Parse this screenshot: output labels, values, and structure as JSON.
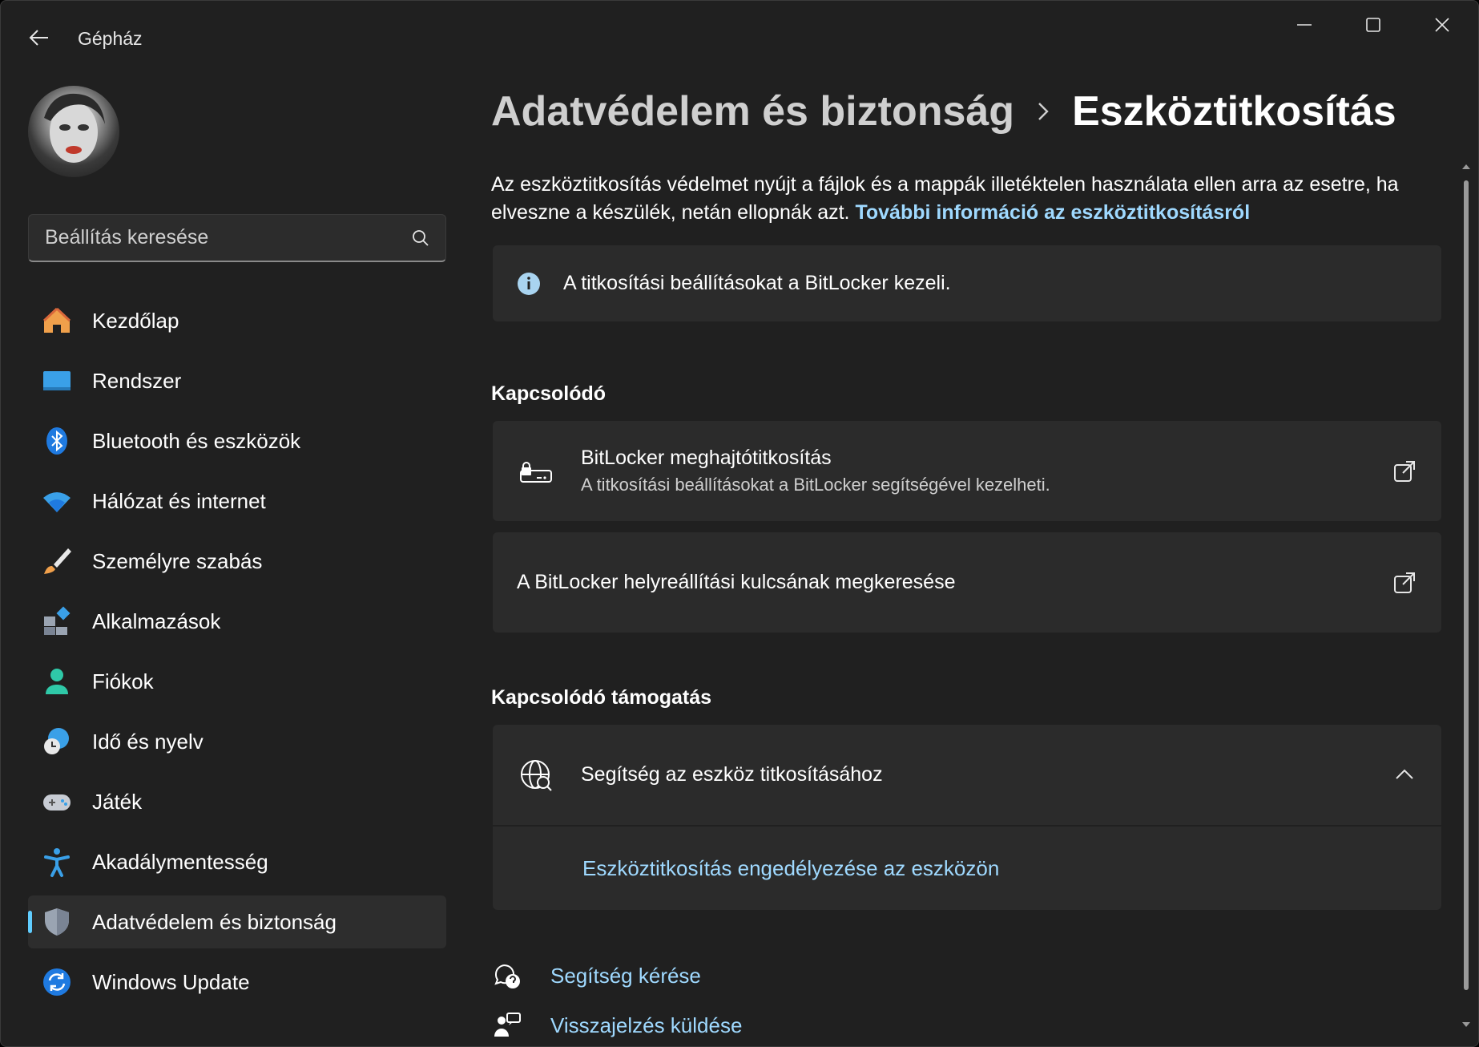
{
  "window": {
    "title": "Gépház"
  },
  "sidebar": {
    "search_placeholder": "Beállítás keresése",
    "items": [
      {
        "label": "Kezdőlap",
        "icon": "home-icon"
      },
      {
        "label": "Rendszer",
        "icon": "display-icon"
      },
      {
        "label": "Bluetooth és eszközök",
        "icon": "bluetooth-icon"
      },
      {
        "label": "Hálózat és internet",
        "icon": "wifi-icon"
      },
      {
        "label": "Személyre szabás",
        "icon": "brush-icon"
      },
      {
        "label": "Alkalmazások",
        "icon": "apps-icon"
      },
      {
        "label": "Fiókok",
        "icon": "person-icon"
      },
      {
        "label": "Idő és nyelv",
        "icon": "globe-clock-icon"
      },
      {
        "label": "Játék",
        "icon": "gamepad-icon"
      },
      {
        "label": "Akadálymentesség",
        "icon": "accessibility-icon"
      },
      {
        "label": "Adatvédelem és biztonság",
        "icon": "shield-icon",
        "active": true
      },
      {
        "label": "Windows Update",
        "icon": "update-icon"
      }
    ]
  },
  "breadcrumb": {
    "parent": "Adatvédelem és biztonság",
    "current": "Eszköztitkosítás"
  },
  "description": {
    "text": "Az eszköztitkosítás védelmet nyújt a fájlok és a mappák illetéktelen használata ellen arra az esetre, ha elveszne a készülék, netán ellopnák azt.",
    "link": "További információ az eszköztitkosításról"
  },
  "info": {
    "text": "A titkosítási beállításokat a BitLocker kezeli."
  },
  "related": {
    "title": "Kapcsolódó",
    "bitlocker": {
      "title": "BitLocker meghajtótitkosítás",
      "subtitle": "A titkosítási beállításokat a BitLocker segítségével kezelheti."
    },
    "recovery": {
      "title": "A BitLocker helyreállítási kulcsának megkeresése"
    }
  },
  "support": {
    "title": "Kapcsolódó támogatás",
    "help": {
      "title": "Segítség az eszköz titkosításához",
      "link": "Eszköztitkosítás engedélyezése az eszközön"
    }
  },
  "footer": {
    "get_help": "Segítség kérése",
    "feedback": "Visszajelzés küldése"
  },
  "colors": {
    "accent": "#60cdff",
    "link": "#9fd9ff",
    "background": "#202020",
    "card": "#2b2b2b"
  }
}
